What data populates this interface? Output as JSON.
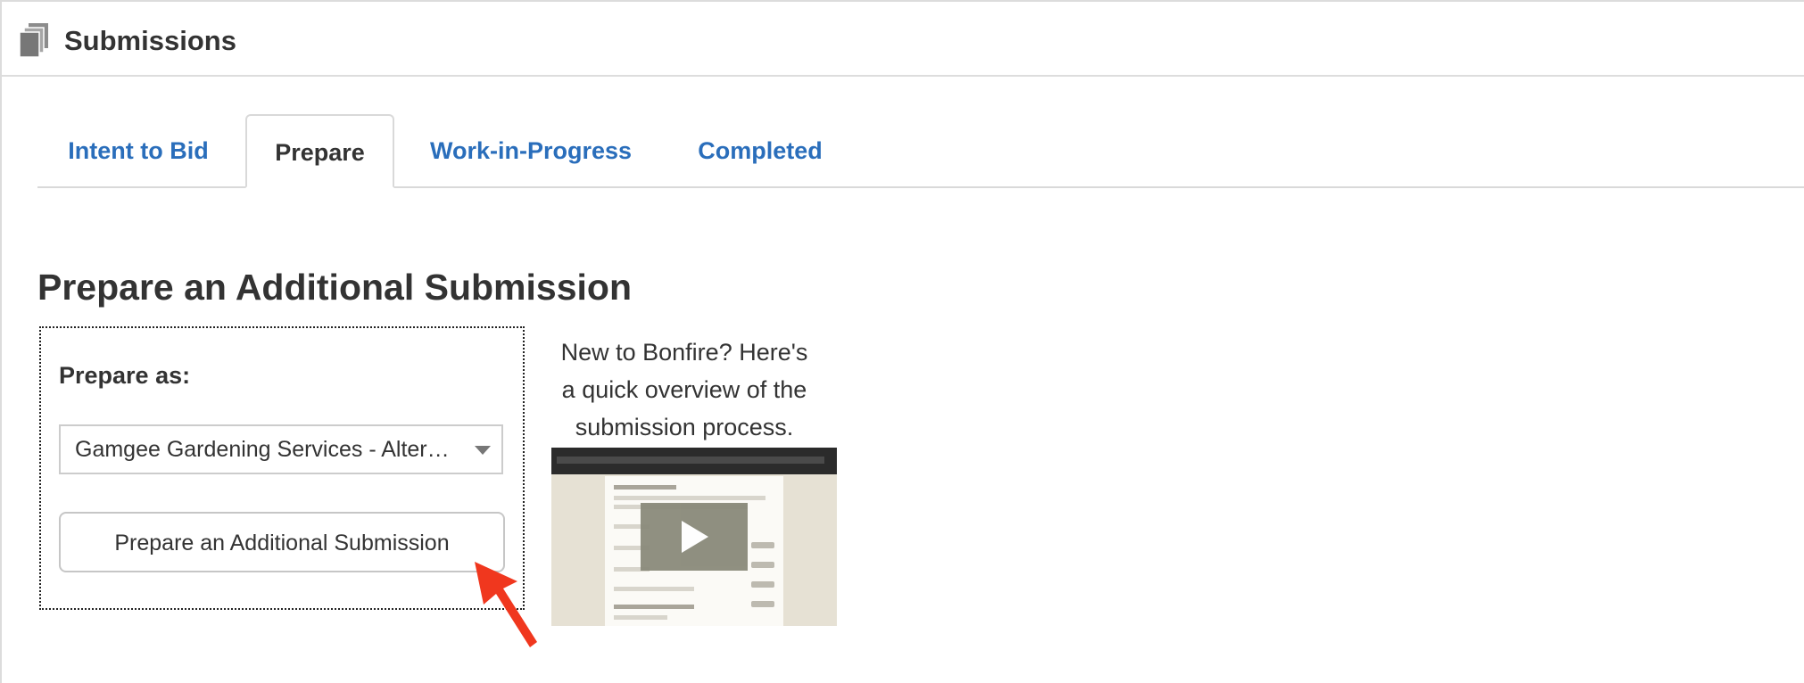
{
  "header": {
    "title": "Submissions",
    "icon": "document-stack-icon"
  },
  "tabs": [
    {
      "label": "Intent to Bid",
      "active": false
    },
    {
      "label": "Prepare",
      "active": true
    },
    {
      "label": "Work-in-Progress",
      "active": false
    },
    {
      "label": "Completed",
      "active": false
    }
  ],
  "main": {
    "section_title": "Prepare an Additional Submission",
    "prepare_box": {
      "label": "Prepare as:",
      "select_value": "Gamgee Gardening Services - Alter…",
      "button_label": "Prepare an Additional Submission"
    },
    "overview": {
      "text_line1": "New to Bonfire? Here's",
      "text_line2": "a quick overview of the",
      "text_line3": "submission process.",
      "video_icon": "play-icon"
    }
  },
  "colors": {
    "link": "#2a6ebb",
    "text": "#333333",
    "annotation_arrow": "#f0371e"
  }
}
